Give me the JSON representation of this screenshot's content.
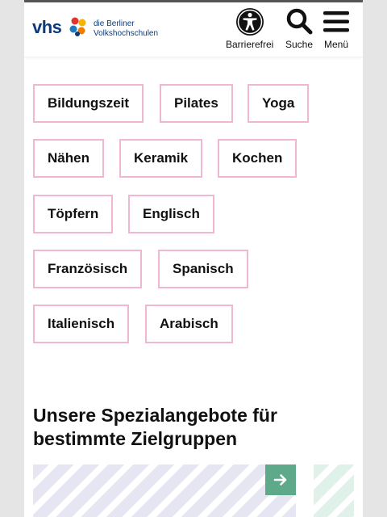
{
  "header": {
    "logo": {
      "brand": "vhs",
      "line1": "die Berliner",
      "line2": "Volkshochschulen"
    },
    "buttons": [
      {
        "label": "Barrierefrei",
        "icon": "accessibility-icon"
      },
      {
        "label": "Suche",
        "icon": "search-icon"
      },
      {
        "label": "Menü",
        "icon": "hamburger-menu-icon"
      }
    ]
  },
  "tags": [
    "Bildungszeit",
    "Pilates",
    "Yoga",
    "Nähen",
    "Keramik",
    "Kochen",
    "Töpfern",
    "Englisch",
    "Französisch",
    "Spanisch",
    "Italienisch",
    "Arabisch"
  ],
  "section": {
    "title": "Unsere Spezialangebote für bestimmte Zielgruppen"
  },
  "colors": {
    "tag_border": "#f0b7d2",
    "brand_blue": "#0b3a7e",
    "arrow_button": "#5ea98a"
  }
}
